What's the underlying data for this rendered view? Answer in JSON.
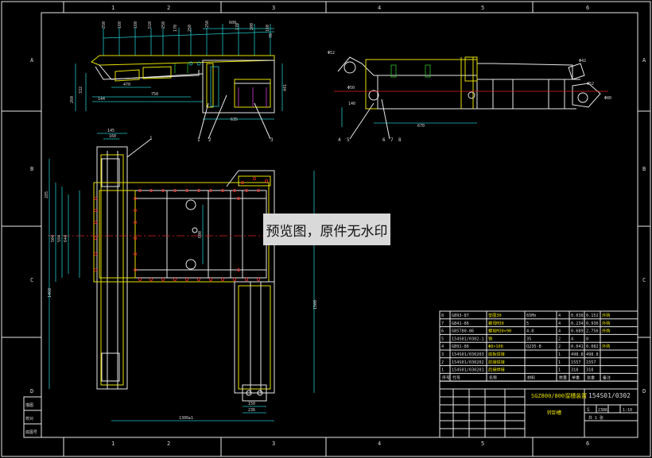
{
  "border": {
    "columns": [
      "1",
      "2",
      "3",
      "4",
      "5",
      "6"
    ],
    "rows": [
      "A",
      "B",
      "C",
      "D"
    ]
  },
  "left_strip": [
    "描图",
    "校对",
    "底图号"
  ],
  "top_view_dims": [
    "250",
    "160",
    "160",
    "510",
    "250",
    "170",
    "250",
    "250",
    "600",
    "170",
    "200",
    "160",
    "70",
    "144",
    "750",
    "260",
    "332",
    "470",
    "635",
    "441"
  ],
  "side_view_dims": [
    "Φ52",
    "Φ42",
    "Φ50",
    "Φ52",
    "Φ80",
    "140",
    "670"
  ],
  "side_view_callouts": [
    "4",
    "5",
    "6",
    "7",
    "8"
  ],
  "top_view_callouts": [
    "1",
    "2",
    "3"
  ],
  "plan_dims": [
    "145",
    "160",
    "285",
    "504",
    "594",
    "644",
    "600",
    "1460",
    "1500",
    "1300±1",
    "236",
    "150"
  ],
  "plan_callouts": [
    "1"
  ],
  "bom": {
    "rows": [
      {
        "no": "8",
        "code": "GB93-87",
        "name": "垫圈30",
        "material": "65Mn",
        "qty": "4",
        "unit": "0.038",
        "total": "0.152",
        "note": "外购"
      },
      {
        "no": "7",
        "code": "GB41-86",
        "name": "螺母M30",
        "material": "5",
        "qty": "4",
        "unit": "0.234",
        "total": "0.936",
        "note": "外购"
      },
      {
        "no": "6",
        "code": "GB5780-86",
        "name": "螺栓M30×90",
        "material": "4.8",
        "qty": "4",
        "unit": "0.689",
        "total": "2.756",
        "note": "外购"
      },
      {
        "no": "5",
        "code": "154S01/0302-1",
        "name": "销",
        "material": "35",
        "qty": "2",
        "unit": "4",
        "total": "8",
        "note": ""
      },
      {
        "no": "4",
        "code": "GB91-86",
        "name": "Φ8×100",
        "material": "Q235-B",
        "qty": "2",
        "unit": "0.041",
        "total": "0.082",
        "note": "外购"
      },
      {
        "no": "3",
        "code": "154S01/030203",
        "name": "底板焊接",
        "material": "",
        "qty": "1",
        "unit": "498.8",
        "total": "498.8",
        "note": ""
      },
      {
        "no": "2",
        "code": "154S01/030202",
        "name": "前接焊接",
        "material": "",
        "qty": "1",
        "unit": "1557",
        "total": "1557",
        "note": ""
      },
      {
        "no": "1",
        "code": "154S01/030201",
        "name": "后接焊接",
        "material": "",
        "qty": "1",
        "unit": "318",
        "total": "318",
        "note": ""
      }
    ],
    "header": [
      "序号",
      "代号",
      "名称",
      "材料",
      "数量",
      "单重",
      "总重",
      "备注"
    ]
  },
  "title_block": {
    "product": "SGZ800/800溜槽装置",
    "drawing_no": "154S01/0302",
    "part_name": "转卸槽",
    "sheet": "共 1 张",
    "scale_label": "1:10",
    "mark": "S",
    "weight": "2386"
  },
  "stamp_text": "预览图，原件无水印"
}
